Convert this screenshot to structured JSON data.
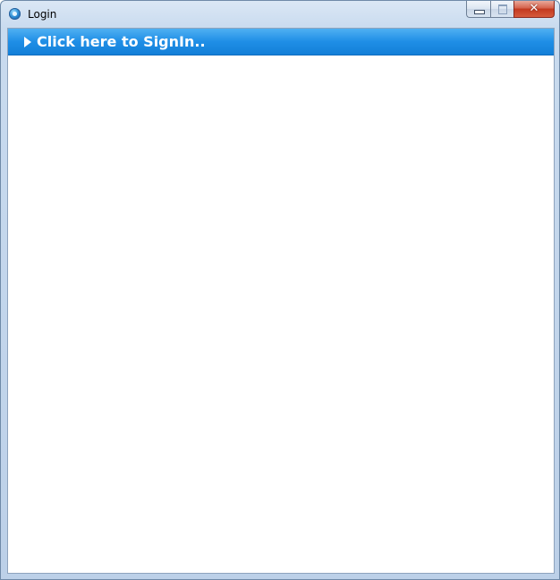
{
  "window": {
    "title": "Login",
    "app_icon": "app-globe-icon",
    "controls": {
      "minimize_icon": "minimize-icon",
      "maximize_icon": "maximize-icon",
      "close_icon": "close-icon",
      "close_glyph": "✕"
    }
  },
  "expander": {
    "label": "Click here to SignIn..",
    "arrow_icon": "triangle-right-icon",
    "expanded": false,
    "accent_color": "#1f8ee6"
  }
}
